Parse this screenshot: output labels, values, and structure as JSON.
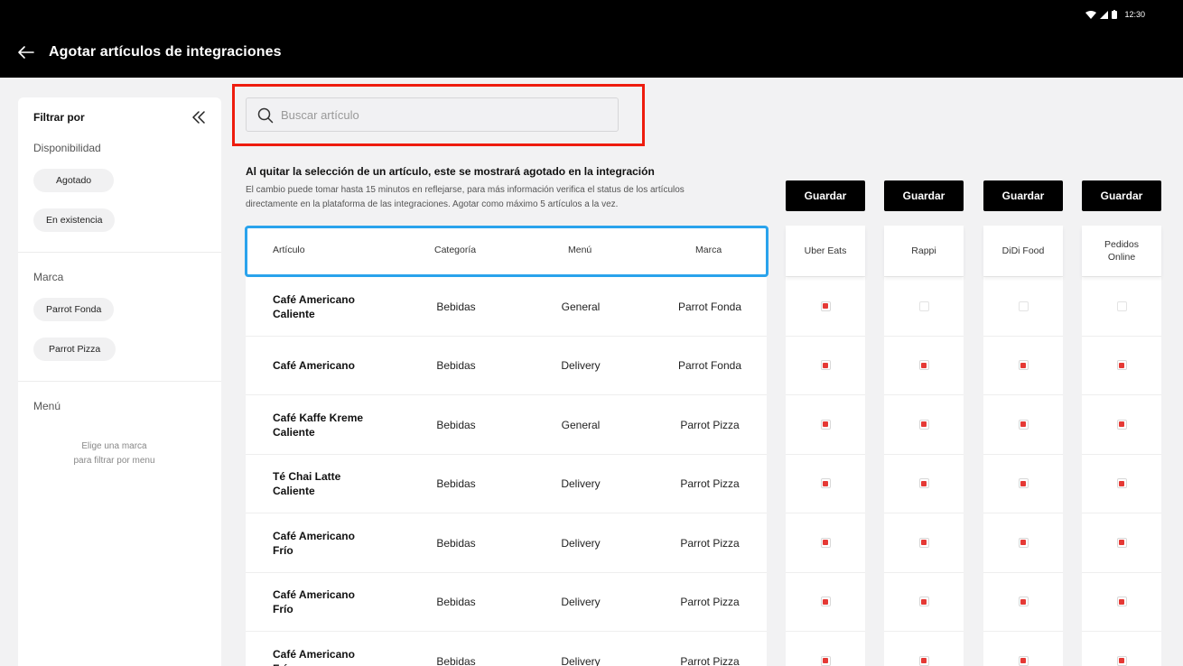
{
  "status_bar": {
    "time": "12:30"
  },
  "header": {
    "title": "Agotar artículos de integraciones"
  },
  "sidebar": {
    "title": "Filtrar por",
    "availability": {
      "label": "Disponibilidad",
      "options": [
        "Agotado",
        "En existencia"
      ]
    },
    "brand": {
      "label": "Marca",
      "options": [
        "Parrot Fonda",
        "Parrot Pizza"
      ]
    },
    "menu": {
      "label": "Menú",
      "hint_line1": "Elige una marca",
      "hint_line2": "para filtrar por menu"
    }
  },
  "search": {
    "placeholder": "Buscar artículo"
  },
  "info": {
    "title": "Al quitar la selección de un artículo, este se mostrará agotado en la integración",
    "line1": "El cambio puede tomar hasta 15 minutos en reflejarse, para más información verifica el status de los artículos",
    "line2": "directamente en la plataforma de las integraciones. Agotar como máximo 5 artículos a la vez."
  },
  "table": {
    "columns": [
      "Artículo",
      "Categoría",
      "Menú",
      "Marca"
    ],
    "rows": [
      {
        "name_line1": "Café Americano",
        "name_line2": "Caliente",
        "category": "Bebidas",
        "menu": "General",
        "brand": "Parrot Fonda"
      },
      {
        "name_line1": "Café Americano",
        "name_line2": "",
        "category": "Bebidas",
        "menu": "Delivery",
        "brand": "Parrot Fonda"
      },
      {
        "name_line1": "Café Kaffe Kreme",
        "name_line2": "Caliente",
        "category": "Bebidas",
        "menu": "General",
        "brand": "Parrot Pizza"
      },
      {
        "name_line1": "Té Chai Latte",
        "name_line2": "Caliente",
        "category": "Bebidas",
        "menu": "Delivery",
        "brand": "Parrot Pizza"
      },
      {
        "name_line1": "Café Americano",
        "name_line2": "Frío",
        "category": "Bebidas",
        "menu": "Delivery",
        "brand": "Parrot Pizza"
      },
      {
        "name_line1": "Café Americano",
        "name_line2": "Frío",
        "category": "Bebidas",
        "menu": "Delivery",
        "brand": "Parrot Pizza"
      },
      {
        "name_line1": "Café Americano",
        "name_line2": "Frío",
        "category": "Bebidas",
        "menu": "Delivery",
        "brand": "Parrot Pizza"
      }
    ]
  },
  "integrations": [
    {
      "name_line1": "Uber Eats",
      "name_line2": "",
      "save_label": "Guardar",
      "checked": [
        true,
        true,
        true,
        true,
        true,
        true,
        true
      ]
    },
    {
      "name_line1": "Rappi",
      "name_line2": "",
      "save_label": "Guardar",
      "checked": [
        false,
        true,
        true,
        true,
        true,
        true,
        true
      ]
    },
    {
      "name_line1": "DiDi Food",
      "name_line2": "",
      "save_label": "Guardar",
      "checked": [
        false,
        true,
        true,
        true,
        true,
        true,
        true
      ]
    },
    {
      "name_line1": "Pedidos",
      "name_line2": "Online",
      "save_label": "Guardar",
      "checked": [
        false,
        true,
        true,
        true,
        true,
        true,
        true
      ]
    }
  ],
  "colors": {
    "accent_red": "#e53935",
    "highlight_red": "#ee1c0e",
    "highlight_blue": "#2aa3ec"
  }
}
